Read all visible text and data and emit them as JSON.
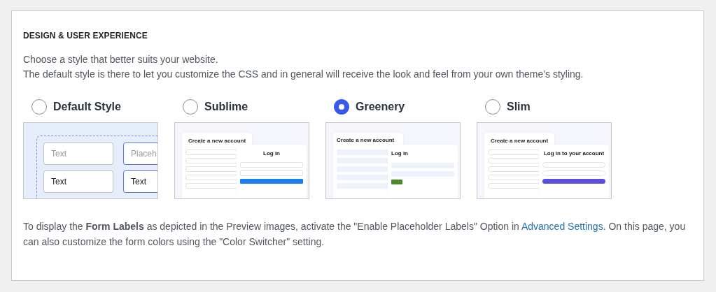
{
  "section_title": "DESIGN & USER EXPERIENCE",
  "description": [
    "Choose a style that better suits your website.",
    "The default style is there to let you customize the CSS and in general will receive the look and feel from your own theme’s styling."
  ],
  "styles": [
    {
      "label": "Default Style",
      "selected": false,
      "kind": "default",
      "preview_texts": [
        "Text",
        "Placeh",
        "Text",
        "Text"
      ]
    },
    {
      "label": "Sublime",
      "selected": false,
      "kind": "sublime",
      "signup_heading": "Create a new account",
      "login_heading": "Log in"
    },
    {
      "label": "Greenery",
      "selected": true,
      "kind": "greenery",
      "signup_heading": "Create a new account",
      "login_heading": "Log in"
    },
    {
      "label": "Slim",
      "selected": false,
      "kind": "slim",
      "signup_heading": "Create a new account",
      "login_heading": "Log in to your account"
    }
  ],
  "note": {
    "before": "To display the **Form Labels** as depicted in the Preview images, activate the \"Enable Placeholder Labels\" Option in ",
    "link": "Advanced Settings",
    "after": ". On this page, you can also customize the form colors using the \"Color Switcher\" setting."
  }
}
